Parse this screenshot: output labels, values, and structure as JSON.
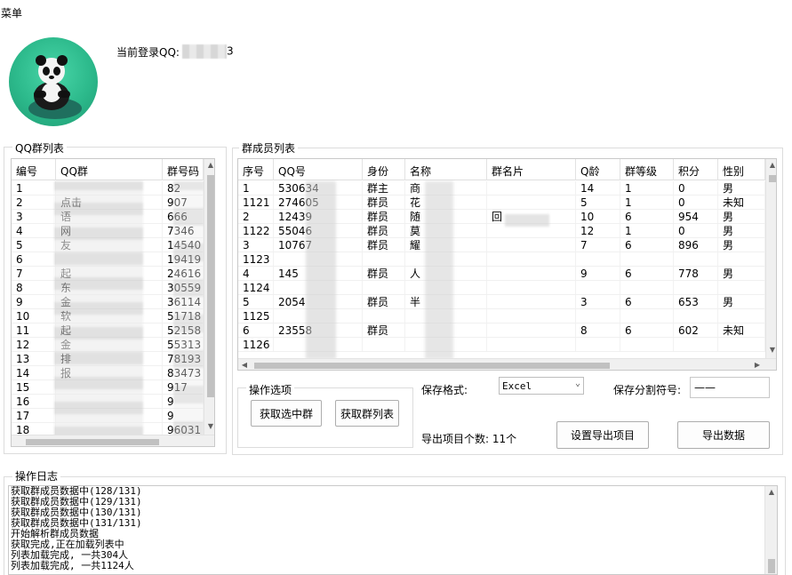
{
  "menu": {
    "label": "菜单"
  },
  "login": {
    "label": "当前登录QQ:",
    "value_suffix": "3"
  },
  "group_list": {
    "title": "QQ群列表",
    "columns": [
      "编号",
      "QQ群",
      "群号码"
    ],
    "rows": [
      [
        "1",
        "",
        "82"
      ],
      [
        "2",
        "点击",
        "907"
      ],
      [
        "3",
        "语",
        "666"
      ],
      [
        "4",
        "网",
        "7346"
      ],
      [
        "5",
        "友",
        "14540"
      ],
      [
        "6",
        "",
        "19419"
      ],
      [
        "7",
        "起",
        "24616"
      ],
      [
        "8",
        "东",
        "30559"
      ],
      [
        "9",
        "金",
        "36114"
      ],
      [
        "10",
        "软",
        "51718"
      ],
      [
        "11",
        "起",
        "52158"
      ],
      [
        "12",
        "金",
        "55313"
      ],
      [
        "13",
        "排",
        "78193"
      ],
      [
        "14",
        "报",
        "83473"
      ],
      [
        "15",
        "",
        "917"
      ],
      [
        "16",
        "",
        "9"
      ],
      [
        "17",
        "",
        "9"
      ],
      [
        "18",
        "",
        "96031"
      ]
    ]
  },
  "member_list": {
    "title": "群成员列表",
    "columns": [
      "序号",
      "QQ号",
      "身份",
      "名称",
      "群名片",
      "Q龄",
      "群等级",
      "积分",
      "性别"
    ],
    "rows": [
      [
        "1",
        "530634",
        "群主",
        "商",
        "",
        "14",
        "1",
        "0",
        "男"
      ],
      [
        "1121",
        "274605",
        "群员",
        "花",
        "",
        "5",
        "1",
        "0",
        "未知"
      ],
      [
        "2",
        "12439",
        "群员",
        "随",
        "回",
        "10",
        "6",
        "954",
        "男"
      ],
      [
        "1122",
        "55046",
        "群员",
        "莫",
        "",
        "12",
        "1",
        "0",
        "男"
      ],
      [
        "3",
        "10767",
        "群员",
        "耀",
        "",
        "7",
        "6",
        "896",
        "男"
      ],
      [
        "1123",
        "",
        "",
        "",
        "",
        "",
        "",
        "",
        ""
      ],
      [
        "4",
        "145",
        "群员",
        "人",
        "",
        "9",
        "6",
        "778",
        "男"
      ],
      [
        "1124",
        "",
        "",
        "",
        "",
        "",
        "",
        "",
        ""
      ],
      [
        "5",
        "2054",
        "群员",
        "半",
        "",
        "3",
        "6",
        "653",
        "男"
      ],
      [
        "1125",
        "",
        "",
        "",
        "",
        "",
        "",
        "",
        ""
      ],
      [
        "6",
        "23558",
        "群员",
        "",
        "",
        "8",
        "6",
        "602",
        "未知"
      ],
      [
        "1126",
        "",
        "",
        "",
        "",
        "",
        "",
        "",
        ""
      ]
    ]
  },
  "ops": {
    "title": "操作选项",
    "get_selected": "获取选中群",
    "get_list": "获取群列表"
  },
  "export": {
    "format_label": "保存格式:",
    "format_value": "Excel",
    "sep_label": "保存分割符号:",
    "sep_value": "——",
    "count_text": "导出项目个数: 11个",
    "set_items": "设置导出项目",
    "export": "导出数据"
  },
  "log": {
    "title": "操作日志",
    "lines": [
      "获取群成员数据中(128/131)",
      "获取群成员数据中(129/131)",
      "获取群成员数据中(130/131)",
      "获取群成员数据中(131/131)",
      "开始解析群成员数据",
      "获取完成,正在加载列表中",
      "列表加载完成, 一共304人",
      "列表加载完成, 一共1124人"
    ]
  }
}
